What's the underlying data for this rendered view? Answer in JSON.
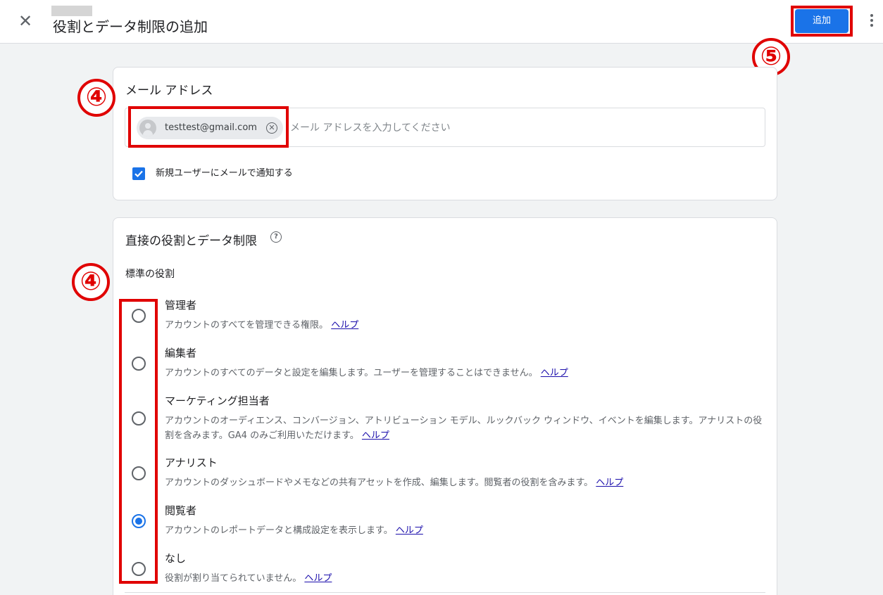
{
  "header": {
    "title": "役割とデータ制限の追加",
    "add_label": "追加"
  },
  "annotations": {
    "step_email": "④",
    "step_roles": "④",
    "step_add": "⑤"
  },
  "email_section": {
    "title": "メール アドレス",
    "chip_email": "testtest@gmail.com",
    "placeholder": "メール アドレスを入力してください",
    "notify_label": "新規ユーザーにメールで通知する",
    "notify_checked": true
  },
  "roles_section": {
    "title": "直接の役割とデータ制限",
    "subtitle": "標準の役割",
    "help_link": "ヘルプ",
    "selected": "閲覧者",
    "roles": [
      {
        "name": "管理者",
        "description": "アカウントのすべてを管理できる権限。"
      },
      {
        "name": "編集者",
        "description": "アカウントのすべてのデータと設定を編集します。ユーザーを管理することはできません。"
      },
      {
        "name": "マーケティング担当者",
        "description": "アカウントのオーディエンス、コンバージョン、アトリビューション モデル、ルックバック ウィンドウ、イベントを編集します。アナリストの役割を含みます。GA4 のみご利用いただけます。"
      },
      {
        "name": "アナリスト",
        "description": "アカウントのダッシュボードやメモなどの共有アセットを作成、編集します。閲覧者の役割を含みます。"
      },
      {
        "name": "閲覧者",
        "description": "アカウントのレポートデータと構成設定を表示します。"
      },
      {
        "name": "なし",
        "description": "役割が割り当てられていません。"
      }
    ]
  },
  "colors": {
    "accent": "#1a73e8",
    "annotation_red": "#e00000",
    "link": "#1a0dab"
  }
}
